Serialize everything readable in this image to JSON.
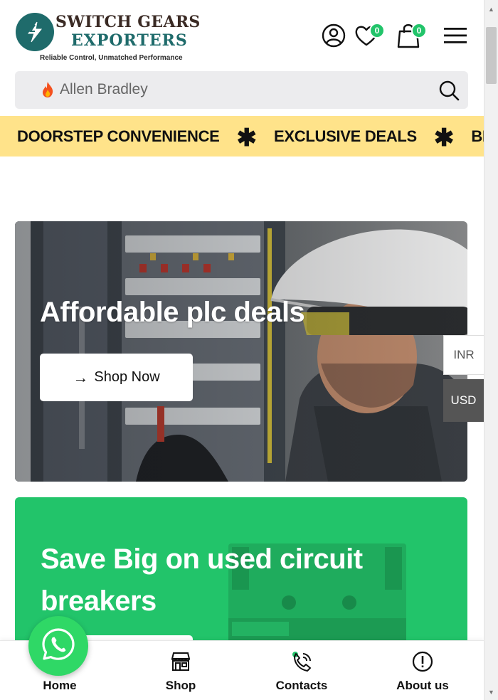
{
  "header": {
    "logo": {
      "line1": "SWITCH GEARS",
      "line2": "EXPORTERS",
      "tagline": "Reliable Control, Unmatched Performance"
    },
    "icons": {
      "account": "user-circle-icon",
      "wishlist": "heart-icon",
      "cart": "shopping-bag-icon",
      "menu": "hamburger-menu-icon"
    },
    "wishlist_count": "0",
    "cart_count": "0"
  },
  "search": {
    "placeholder": "Allen Bradley"
  },
  "marquee": {
    "items": [
      "DOORSTEP CONVENIENCE",
      "EXCLUSIVE DEALS",
      "BEST"
    ]
  },
  "hero1": {
    "title": "Affordable plc deals",
    "button_label": "Shop Now"
  },
  "hero2": {
    "title": "Save Big on used circuit breakers"
  },
  "currency": {
    "options": [
      "INR",
      "USD"
    ],
    "selected": "USD"
  },
  "bottom_nav": {
    "items": [
      {
        "label": "Home",
        "icon": "home-icon"
      },
      {
        "label": "Shop",
        "icon": "store-icon"
      },
      {
        "label": "Contacts",
        "icon": "phone-icon"
      },
      {
        "label": "About us",
        "icon": "info-icon"
      }
    ]
  },
  "colors": {
    "brand_teal": "#1f6b6b",
    "badge_green": "#22c46a",
    "marquee_bg": "#ffe38a",
    "hero2_bg": "#22c46a",
    "whatsapp_green": "#2fd866"
  }
}
